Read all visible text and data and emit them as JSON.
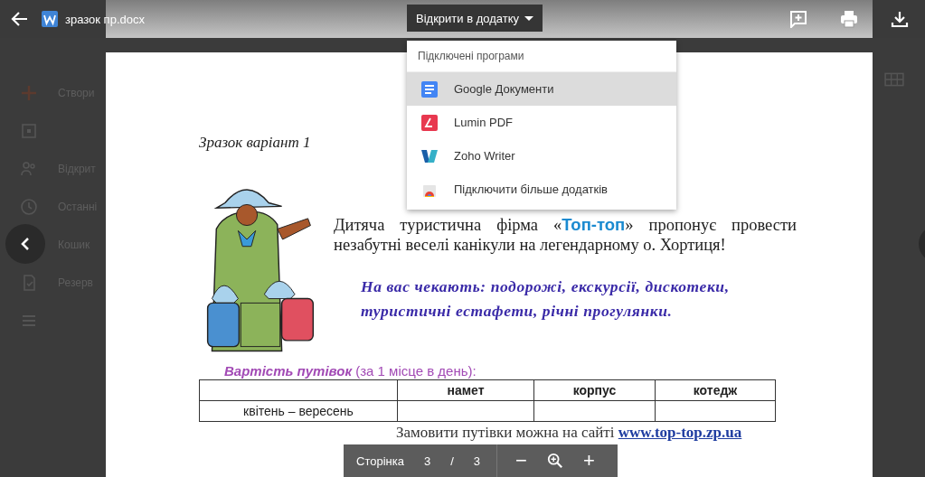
{
  "top_bar": {
    "file_name": "зразок пр.docx",
    "open_with": "Відкрити в додатку"
  },
  "open_menu": {
    "header": "Підключені програми",
    "items": [
      {
        "kind": "docs",
        "label": "Google Документи",
        "selected": true
      },
      {
        "kind": "lumin",
        "label": "Lumin PDF",
        "selected": false
      },
      {
        "kind": "zoho",
        "label": "Zoho Writer",
        "selected": false
      },
      {
        "kind": "more",
        "label": "Підключити більше додатків",
        "selected": false
      }
    ]
  },
  "sidebar": {
    "items": [
      {
        "kind": "new",
        "label": "Створи"
      },
      {
        "kind": "drive"
      },
      {
        "kind": "shared",
        "label": "Відкрит"
      },
      {
        "kind": "recent",
        "label": "Останні"
      },
      {
        "kind": "trash",
        "label": "Кошик"
      },
      {
        "kind": "backup",
        "label": "Резерв"
      },
      {
        "kind": "storage"
      }
    ]
  },
  "document": {
    "heading": "Зразок варіант 1",
    "intro": "Дитяча  туристична фірма «**Топ-топ**» пропонує провести незабутні веселі канікули на легендарному о. Хортиця!",
    "offer": "На вас чекають: подорожі, екскурсії, дискотеки, туристичні естафети, річні прогулянки.",
    "price_caption": "**Вартість путівок** (за 1 місце в день):",
    "table": {
      "columns": [
        "",
        "намет",
        "корпус",
        "котедж"
      ],
      "rows": [
        [
          "квітень – вересень",
          "",
          "",
          ""
        ]
      ]
    },
    "order_text": "Замовити путівки можна на сайті",
    "order_link": "www.top-top.zp.ua"
  },
  "page_toolbar": {
    "label": "Сторінка",
    "current": "3",
    "separator": "/",
    "total": "3",
    "zoom_out": "−",
    "zoom_in": "+"
  }
}
